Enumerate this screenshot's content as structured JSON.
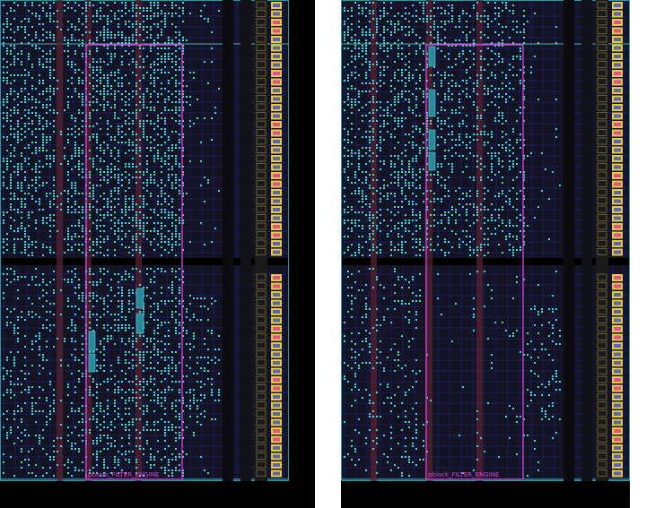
{
  "panels": [
    {
      "id": "left",
      "pblock_label": "pblock_FILTER_ENGINE",
      "utilization": "dense"
    },
    {
      "id": "right",
      "pblock_label": "pblock_FILTER_ENGINE",
      "utilization": "sparse"
    }
  ],
  "colors": {
    "background": "#000000",
    "device_fill": "#141420",
    "grid_line": "#1c1c9a",
    "clock_region_line": "#33bbbb",
    "cell": "#44dddd",
    "pblock": "#dd44dd",
    "bram_column": "#552233",
    "io_bank": "#e6c84a",
    "io_pad": "#dd5588"
  },
  "icons": {
    "pblock": "rectangle-outline",
    "io": "square-tile"
  }
}
